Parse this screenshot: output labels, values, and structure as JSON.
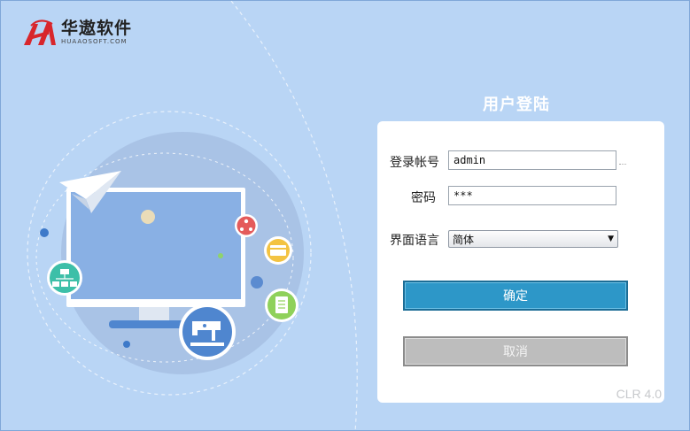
{
  "logo": {
    "title": "华遨软件",
    "subtitle": "HUAAOSOFT.COM"
  },
  "login": {
    "title": "用户登陆",
    "account_label": "登录帐号",
    "account_value": "admin",
    "password_label": "密码",
    "password_value": "***",
    "language_label": "界面语言",
    "language_selected": "简体",
    "ok_label": "确定",
    "cancel_label": "取消"
  },
  "footer": {
    "version": "CLR 4.0"
  },
  "colors": {
    "background": "#b9d5f5",
    "ok_button": "#2d97c8",
    "cancel_button": "#bdbdbd",
    "logo_red": "#d8262c"
  },
  "icons": {
    "illustration": [
      "paper-plane-icon",
      "monitor-icon",
      "sitemap-icon",
      "org-chart-icon",
      "payment-card-icon",
      "document-icon",
      "sewing-machine-icon"
    ]
  }
}
